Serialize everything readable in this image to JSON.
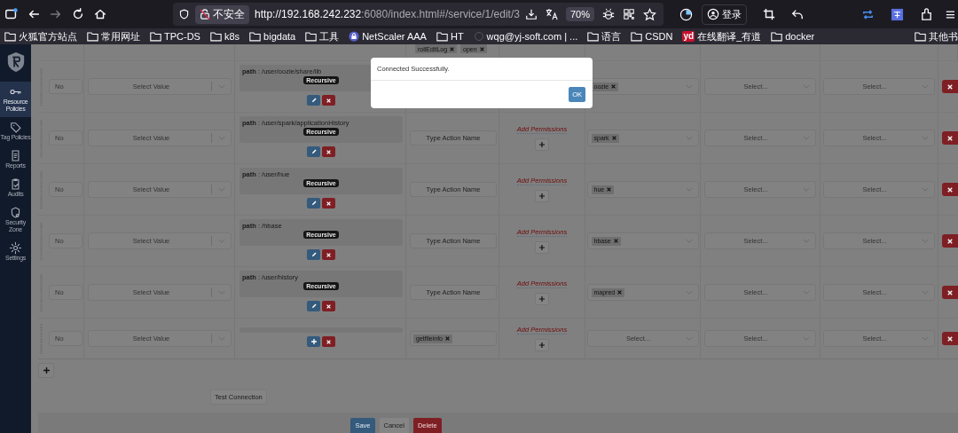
{
  "browser": {
    "nav_buttons": [
      {
        "kind": "tabs",
        "disabled": false
      },
      {
        "kind": "back",
        "disabled": false
      },
      {
        "kind": "forward",
        "disabled": true
      },
      {
        "kind": "reload",
        "disabled": false
      },
      {
        "kind": "home",
        "disabled": false
      }
    ],
    "security_label": "不安全",
    "url_host": "http://192.168.242.232",
    "url_rest": ":6080/index.html#/service/1/edit/3",
    "zoom": "70%",
    "account_label": "登录"
  },
  "bookmarks": [
    {
      "label": "火狐官方站点",
      "kind": "folder"
    },
    {
      "label": "常用网址",
      "kind": "folder"
    },
    {
      "label": "TPC-DS",
      "kind": "folder"
    },
    {
      "label": "k8s",
      "kind": "folder"
    },
    {
      "label": "bigdata",
      "kind": "folder"
    },
    {
      "label": "工具",
      "kind": "folder"
    },
    {
      "label": "NetScaler AAA",
      "kind": "lock"
    },
    {
      "label": "HT",
      "kind": "folder"
    },
    {
      "label": "wqg@yj-soft.com | ...",
      "kind": "site"
    },
    {
      "label": "语言",
      "kind": "folder"
    },
    {
      "label": "CSDN",
      "kind": "folder"
    },
    {
      "label": "在线翻译_有道",
      "kind": "badge",
      "badge": "yd"
    },
    {
      "label": "docker",
      "kind": "folder"
    }
  ],
  "other_bookmarks": "其他书",
  "sidebar": {
    "items": [
      {
        "label": "Resource Policies",
        "selected": true
      },
      {
        "label": "Tag Policies",
        "selected": false
      },
      {
        "label": "Reports",
        "selected": false
      },
      {
        "label": "Audits",
        "selected": false
      },
      {
        "label": "Security Zone",
        "selected": false
      },
      {
        "label": "Settings",
        "selected": false
      }
    ]
  },
  "table": {
    "top_tags": [
      "rollEditLog",
      "open"
    ],
    "rows": [
      {
        "enabled": "No",
        "condition_placeholder": "Select Value",
        "path_label": "path",
        "path": ": /user/oozie/share/lib",
        "recursive": "Recursive",
        "kind": "edit",
        "users": [
          "oozie"
        ],
        "groups_placeholder": "Select...",
        "roles_placeholder": "Select..."
      },
      {
        "enabled": "No",
        "condition_placeholder": "Select Value",
        "path_label": "path",
        "path": ": /user/spark/applicationHistory",
        "recursive": "Recursive",
        "kind": "edit",
        "action_placeholder": "Type Action Name",
        "permissions": "Add Permissions",
        "users": [
          "spark"
        ],
        "groups_placeholder": "Select...",
        "roles_placeholder": "Select..."
      },
      {
        "enabled": "No",
        "condition_placeholder": "Select Value",
        "path_label": "path",
        "path": ": /user/hue",
        "recursive": "Recursive",
        "kind": "edit",
        "action_placeholder": "Type Action Name",
        "permissions": "Add Permissions",
        "users": [
          "hue"
        ],
        "groups_placeholder": "Select...",
        "roles_placeholder": "Select..."
      },
      {
        "enabled": "No",
        "condition_placeholder": "Select Value",
        "path_label": "path",
        "path": ": /hbase",
        "recursive": "Recursive",
        "kind": "edit",
        "action_placeholder": "Type Action Name",
        "permissions": "Add Permissions",
        "users": [
          "hbase"
        ],
        "groups_placeholder": "Select...",
        "roles_placeholder": "Select..."
      },
      {
        "enabled": "No",
        "condition_placeholder": "Select Value",
        "path_label": "path",
        "path": ": /user/history",
        "recursive": "Recursive",
        "kind": "edit",
        "action_placeholder": "Type Action Name",
        "permissions": "Add Permissions",
        "users": [
          "mapred"
        ],
        "groups_placeholder": "Select...",
        "roles_placeholder": "Select..."
      },
      {
        "enabled": "No",
        "condition_placeholder": "Select Value",
        "kind": "add",
        "action_tags": [
          "getfileinfo"
        ],
        "permissions": "Add Permissions",
        "users_placeholder": "Select...",
        "groups_placeholder": "Select...",
        "roles_placeholder": "Select..."
      }
    ]
  },
  "test_connection": "Test Connection",
  "footer_buttons": [
    {
      "label": "Save",
      "kind": "primary"
    },
    {
      "label": "Cancel",
      "kind": "default"
    },
    {
      "label": "Delete",
      "kind": "danger"
    }
  ],
  "modal": {
    "message": "Connected Successfully.",
    "button": "OK"
  }
}
